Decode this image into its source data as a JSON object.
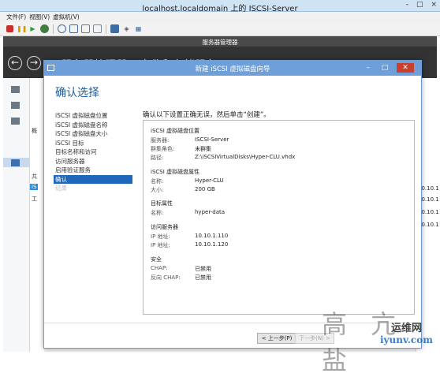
{
  "vm": {
    "title": "localhost.localdomain 上的 ISCSI-Server",
    "menu": [
      "文件(F)",
      "视图(V)",
      "虚拟机(V)"
    ],
    "controls": [
      "-",
      "□",
      "×"
    ]
  },
  "server_manager": {
    "title": "服务器管理器",
    "breadcrumb": "服务器管理器 · 文件和存储服务 · iSCSI",
    "left_fragments": [
      "概",
      "共",
      "iS",
      "工"
    ],
    "right_fragments": [
      "10.10.1",
      "10.10.1",
      "10.10.1",
      "10.10.1"
    ]
  },
  "wizard": {
    "title": "新建 iSCSI 虚拟磁盘向导",
    "heading": "确认选择",
    "nav": [
      {
        "label": "iSCSI 虚拟磁盘位置",
        "state": "normal"
      },
      {
        "label": "iSCSI 虚拟磁盘名称",
        "state": "normal"
      },
      {
        "label": "iSCSI 虚拟磁盘大小",
        "state": "normal"
      },
      {
        "label": "iSCSI 目标",
        "state": "normal"
      },
      {
        "label": "目标名称和访问",
        "state": "normal"
      },
      {
        "label": "访问服务器",
        "state": "normal"
      },
      {
        "label": "启用验证服务",
        "state": "normal"
      },
      {
        "label": "确认",
        "state": "active"
      },
      {
        "label": "结果",
        "state": "disabled"
      }
    ],
    "instruction": "确认以下设置正确无误，然后单击“创建”。",
    "summary": {
      "location": {
        "title": "iSCSI 虚拟磁盘位置",
        "server_label": "服务器:",
        "server_value": "ISCSI-Server",
        "cluster_label": "群集角色:",
        "cluster_value": "未群集",
        "path_label": "路径:",
        "path_value": "Z:\\iSCSIVirtualDisks\\Hyper-CLU.vhdx"
      },
      "properties": {
        "title": "iSCSI 虚拟磁盘属性",
        "name_label": "名称:",
        "name_value": "Hyper-CLU",
        "size_label": "大小:",
        "size_value": "200 GB"
      },
      "target": {
        "title": "目标属性",
        "name_label": "名称:",
        "name_value": "hyper-data"
      },
      "access": {
        "title": "访问服务器",
        "ip1_label": "IP 地址:",
        "ip1_value": "10.10.1.110",
        "ip2_label": "IP 地址:",
        "ip2_value": "10.10.1.120"
      },
      "security": {
        "title": "安全",
        "chap_label": "CHAP:",
        "chap_value": "已禁用",
        "rchap_label": "反向 CHAP:",
        "rchap_value": "已禁用"
      }
    },
    "buttons": {
      "prev": "< 上一步(P)",
      "next": "下一步(N) >"
    }
  },
  "watermark": {
    "logo_text": "运维网",
    "domain": "iyunv.com"
  }
}
